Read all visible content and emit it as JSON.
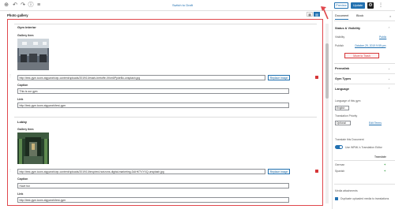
{
  "toolbar": {
    "add_icon": "plus-circle-icon",
    "undo_icon": "undo-icon",
    "redo_icon": "redo-icon",
    "info_icon": "info-icon",
    "list_icon": "list-view-icon",
    "switch_to_draft": "Switch to Draft",
    "preview": "Preview",
    "update": "Update",
    "settings_icon": "gear-icon",
    "more_icon": "more-vertical-icon"
  },
  "block": {
    "title": "Photo gallery",
    "highlight_color": "#e0474c"
  },
  "gallery_items": [
    {
      "section": "Gym interior",
      "image_label": "Gallery item",
      "url": "http://test-gym.icons.stgywork/wp-content/uploads/2019/10/mark-bertoffe-XKm6lPpdeBo-unsplash.jpg",
      "replace_label": "Replace image",
      "caption_label": "Caption",
      "caption": "This is our gym",
      "link_label": "Link",
      "link": "http://test-gym.icons.stgywork/test-gym"
    },
    {
      "section": "Lobby",
      "image_label": "Gallery item",
      "url": "http://test-gym.icons.stgywork/wp-content/uploads/2019/10/inspired-horizons-digital-marketing-DAHKTVYXQ-unsplash.jpg",
      "replace_label": "Replace image",
      "caption_label": "Caption",
      "caption": "Have fun",
      "link_label": "Link",
      "link": "http://test-gym.icons.stgywork/test-gym"
    }
  ],
  "sidebar": {
    "tabs": [
      "Document",
      "Block"
    ],
    "status_visibility": "Status & Visibility",
    "visibility_label": "Visibility",
    "visibility_value": "Public",
    "publish_label": "Publish",
    "publish_value": "October 29, 2019 9:59 pm",
    "move_to_trash": "Move to Trash",
    "permalink": "Permalink",
    "gym_types": "Gym Types",
    "language": "Language",
    "language_of_post": "Language of this gym",
    "language_value": "English",
    "translation_priority": "Translation Priority",
    "priority_value": "Optional",
    "edit_terms": "Edit Terms",
    "translate_doc": "Translate this Document",
    "use_wpml_editor": "Use WPML's Translation Editor",
    "translate_col": "Translate",
    "lang_german": "German",
    "lang_spanish": "Spanish",
    "media_attachments": "Media attachments",
    "duplicate_media": "Duplicate uploaded media to translations"
  }
}
